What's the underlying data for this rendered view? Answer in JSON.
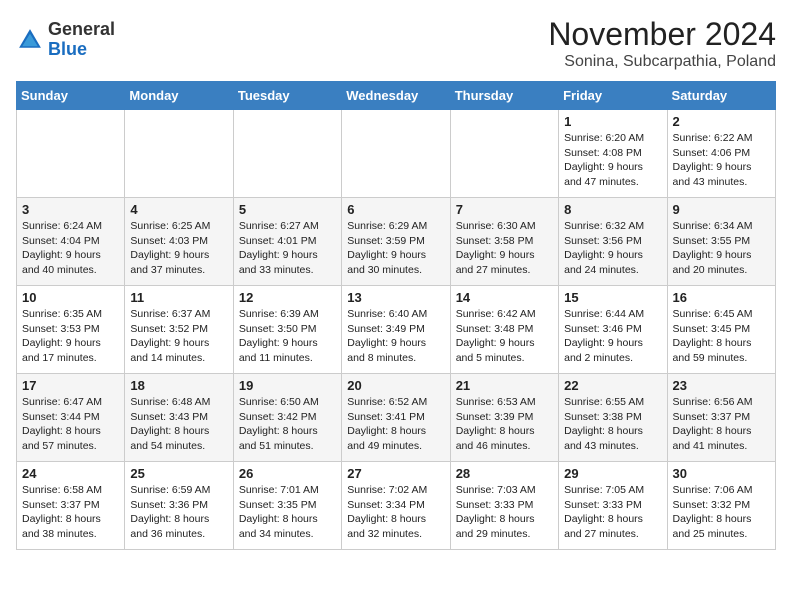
{
  "logo": {
    "general": "General",
    "blue": "Blue"
  },
  "title": "November 2024",
  "location": "Sonina, Subcarpathia, Poland",
  "days_of_week": [
    "Sunday",
    "Monday",
    "Tuesday",
    "Wednesday",
    "Thursday",
    "Friday",
    "Saturday"
  ],
  "weeks": [
    [
      {
        "day": "",
        "info": ""
      },
      {
        "day": "",
        "info": ""
      },
      {
        "day": "",
        "info": ""
      },
      {
        "day": "",
        "info": ""
      },
      {
        "day": "",
        "info": ""
      },
      {
        "day": "1",
        "info": "Sunrise: 6:20 AM\nSunset: 4:08 PM\nDaylight: 9 hours and 47 minutes."
      },
      {
        "day": "2",
        "info": "Sunrise: 6:22 AM\nSunset: 4:06 PM\nDaylight: 9 hours and 43 minutes."
      }
    ],
    [
      {
        "day": "3",
        "info": "Sunrise: 6:24 AM\nSunset: 4:04 PM\nDaylight: 9 hours and 40 minutes."
      },
      {
        "day": "4",
        "info": "Sunrise: 6:25 AM\nSunset: 4:03 PM\nDaylight: 9 hours and 37 minutes."
      },
      {
        "day": "5",
        "info": "Sunrise: 6:27 AM\nSunset: 4:01 PM\nDaylight: 9 hours and 33 minutes."
      },
      {
        "day": "6",
        "info": "Sunrise: 6:29 AM\nSunset: 3:59 PM\nDaylight: 9 hours and 30 minutes."
      },
      {
        "day": "7",
        "info": "Sunrise: 6:30 AM\nSunset: 3:58 PM\nDaylight: 9 hours and 27 minutes."
      },
      {
        "day": "8",
        "info": "Sunrise: 6:32 AM\nSunset: 3:56 PM\nDaylight: 9 hours and 24 minutes."
      },
      {
        "day": "9",
        "info": "Sunrise: 6:34 AM\nSunset: 3:55 PM\nDaylight: 9 hours and 20 minutes."
      }
    ],
    [
      {
        "day": "10",
        "info": "Sunrise: 6:35 AM\nSunset: 3:53 PM\nDaylight: 9 hours and 17 minutes."
      },
      {
        "day": "11",
        "info": "Sunrise: 6:37 AM\nSunset: 3:52 PM\nDaylight: 9 hours and 14 minutes."
      },
      {
        "day": "12",
        "info": "Sunrise: 6:39 AM\nSunset: 3:50 PM\nDaylight: 9 hours and 11 minutes."
      },
      {
        "day": "13",
        "info": "Sunrise: 6:40 AM\nSunset: 3:49 PM\nDaylight: 9 hours and 8 minutes."
      },
      {
        "day": "14",
        "info": "Sunrise: 6:42 AM\nSunset: 3:48 PM\nDaylight: 9 hours and 5 minutes."
      },
      {
        "day": "15",
        "info": "Sunrise: 6:44 AM\nSunset: 3:46 PM\nDaylight: 9 hours and 2 minutes."
      },
      {
        "day": "16",
        "info": "Sunrise: 6:45 AM\nSunset: 3:45 PM\nDaylight: 8 hours and 59 minutes."
      }
    ],
    [
      {
        "day": "17",
        "info": "Sunrise: 6:47 AM\nSunset: 3:44 PM\nDaylight: 8 hours and 57 minutes."
      },
      {
        "day": "18",
        "info": "Sunrise: 6:48 AM\nSunset: 3:43 PM\nDaylight: 8 hours and 54 minutes."
      },
      {
        "day": "19",
        "info": "Sunrise: 6:50 AM\nSunset: 3:42 PM\nDaylight: 8 hours and 51 minutes."
      },
      {
        "day": "20",
        "info": "Sunrise: 6:52 AM\nSunset: 3:41 PM\nDaylight: 8 hours and 49 minutes."
      },
      {
        "day": "21",
        "info": "Sunrise: 6:53 AM\nSunset: 3:39 PM\nDaylight: 8 hours and 46 minutes."
      },
      {
        "day": "22",
        "info": "Sunrise: 6:55 AM\nSunset: 3:38 PM\nDaylight: 8 hours and 43 minutes."
      },
      {
        "day": "23",
        "info": "Sunrise: 6:56 AM\nSunset: 3:37 PM\nDaylight: 8 hours and 41 minutes."
      }
    ],
    [
      {
        "day": "24",
        "info": "Sunrise: 6:58 AM\nSunset: 3:37 PM\nDaylight: 8 hours and 38 minutes."
      },
      {
        "day": "25",
        "info": "Sunrise: 6:59 AM\nSunset: 3:36 PM\nDaylight: 8 hours and 36 minutes."
      },
      {
        "day": "26",
        "info": "Sunrise: 7:01 AM\nSunset: 3:35 PM\nDaylight: 8 hours and 34 minutes."
      },
      {
        "day": "27",
        "info": "Sunrise: 7:02 AM\nSunset: 3:34 PM\nDaylight: 8 hours and 32 minutes."
      },
      {
        "day": "28",
        "info": "Sunrise: 7:03 AM\nSunset: 3:33 PM\nDaylight: 8 hours and 29 minutes."
      },
      {
        "day": "29",
        "info": "Sunrise: 7:05 AM\nSunset: 3:33 PM\nDaylight: 8 hours and 27 minutes."
      },
      {
        "day": "30",
        "info": "Sunrise: 7:06 AM\nSunset: 3:32 PM\nDaylight: 8 hours and 25 minutes."
      }
    ]
  ]
}
